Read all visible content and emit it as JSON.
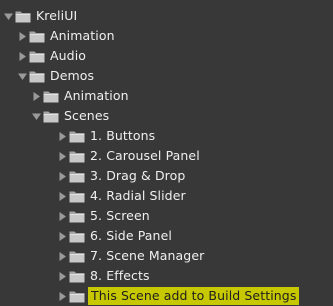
{
  "hierarchy": {
    "items": [
      {
        "label": "KreliUI",
        "expanded": true
      },
      {
        "label": "Animation",
        "expanded": false
      },
      {
        "label": "Audio",
        "expanded": false
      },
      {
        "label": "Demos",
        "expanded": true
      },
      {
        "label": "Animation",
        "expanded": false
      },
      {
        "label": "Scenes",
        "expanded": true
      },
      {
        "label": "1. Buttons",
        "expanded": false
      },
      {
        "label": "2. Carousel Panel",
        "expanded": false
      },
      {
        "label": "3. Drag & Drop",
        "expanded": false
      },
      {
        "label": "4. Radial Slider",
        "expanded": false
      },
      {
        "label": "5. Screen",
        "expanded": false
      },
      {
        "label": "6. Side Panel",
        "expanded": false
      },
      {
        "label": "7. Scene Manager",
        "expanded": false
      },
      {
        "label": "8. Effects",
        "expanded": false
      },
      {
        "label": "This Scene add to Build Settings",
        "expanded": false,
        "highlighted": true
      }
    ]
  },
  "colors": {
    "background": "#383838",
    "text": "#f0f0f0",
    "arrow": "#9a9a9a",
    "folder_body": "#c8c8c8",
    "folder_tab": "#a6a6a6",
    "highlight": "#c8c800"
  }
}
